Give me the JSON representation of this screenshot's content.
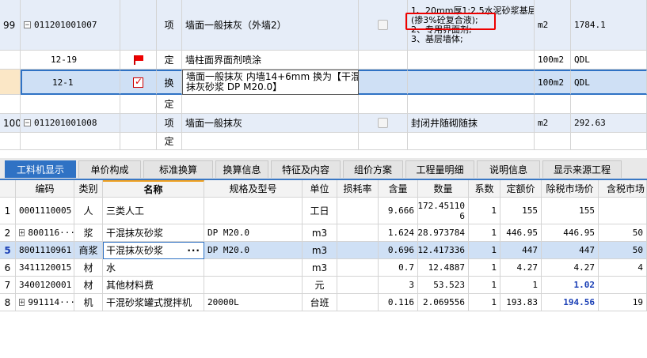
{
  "top_rows": [
    {
      "num": "99",
      "code": "011201001007",
      "type": "项",
      "name": "墙面一般抹灰（外墙2）",
      "feature_lines": [
        "1、20mm厚1:2.5水泥砂浆基层",
        "(掺3%砼复合液);",
        "2、专用界面剂;",
        "3、基层墙体;"
      ],
      "unit": "m2",
      "qty": "1784.1"
    },
    {
      "num": "",
      "code": "12-19",
      "type": "定",
      "name": "墙柱面界面剂喷涂",
      "feature_lines": [],
      "unit": "100m2",
      "qty": "QDL"
    },
    {
      "num": "",
      "code": "12-1",
      "type": "换",
      "name_lines": [
        "墙面一般抹灰 内墙14+6mm  换为【干混",
        "抹灰砂浆 DP M20.0】"
      ],
      "feature_lines": [],
      "unit": "100m2",
      "qty": "QDL"
    },
    {
      "num": "",
      "code": "",
      "type": "定",
      "name": "",
      "feature_lines": [],
      "unit": "",
      "qty": ""
    },
    {
      "num": "100",
      "code": "011201001008",
      "type": "项",
      "name": "墙面一般抹灰",
      "feature_lines": [
        "封闭井随砌随抹"
      ],
      "unit": "m2",
      "qty": "292.63"
    },
    {
      "num": "",
      "code": "",
      "type": "定",
      "name": "",
      "feature_lines": [],
      "unit": "",
      "qty": ""
    }
  ],
  "tabs": [
    "工料机显示",
    "单价构成",
    "标准换算",
    "换算信息",
    "特征及内容",
    "组价方案",
    "工程量明细",
    "说明信息",
    "显示来源工程"
  ],
  "columns": [
    "编码",
    "类别",
    "名称",
    "规格及型号",
    "单位",
    "损耗率",
    "含量",
    "数量",
    "系数",
    "定额价",
    "除税市场价",
    "含税市场"
  ],
  "rows": [
    {
      "idx": "1",
      "code": "0001110005",
      "cat": "人",
      "name": "三类人工",
      "spec": "",
      "unit": "工日",
      "loss": "",
      "content": "9.666",
      "qty_lines": [
        "172.45110",
        "6"
      ],
      "coef": "1",
      "price": "155",
      "market": "155",
      "tax_market": ""
    },
    {
      "idx": "2",
      "code": "800116···",
      "cat": "浆",
      "name": "干混抹灰砂浆",
      "spec": "DP M20.0",
      "unit": "m3",
      "loss": "",
      "content": "1.624",
      "qty_lines": [
        "28.973784"
      ],
      "coef": "1",
      "price": "446.95",
      "market": "446.95",
      "tax_market": "50"
    },
    {
      "idx": "5",
      "code": "8001110961",
      "cat": "商浆",
      "name": "干混抹灰砂浆",
      "spec": "DP M20.0",
      "unit": "m3",
      "loss": "",
      "content": "0.696",
      "qty_lines": [
        "12.417336"
      ],
      "coef": "1",
      "price": "447",
      "market": "447",
      "tax_market": "50"
    },
    {
      "idx": "6",
      "code": "3411120015",
      "cat": "材",
      "name": "水",
      "spec": "",
      "unit": "m3",
      "loss": "",
      "content": "0.7",
      "qty_lines": [
        "12.4887"
      ],
      "coef": "1",
      "price": "4.27",
      "market": "4.27",
      "tax_market": "4"
    },
    {
      "idx": "7",
      "code": "3400120001",
      "cat": "材",
      "name": "其他材料费",
      "spec": "",
      "unit": "元",
      "loss": "",
      "content": "3",
      "qty_lines": [
        "53.523"
      ],
      "coef": "1",
      "price": "1",
      "market": "1.02",
      "tax_market": ""
    },
    {
      "idx": "8",
      "code": "991114···",
      "cat": "机",
      "name": "干混砂浆罐式搅拌机",
      "spec": "20000L",
      "unit": "台班",
      "loss": "",
      "content": "0.116",
      "qty_lines": [
        "2.069556"
      ],
      "coef": "1",
      "price": "193.83",
      "market": "194.56",
      "tax_market": "19"
    }
  ],
  "icons": {
    "tree_expand": "plus-box-icon",
    "tree_collapse": "minus-box-icon",
    "flag": "red-flag-icon",
    "flag_checked": "red-flag-check-icon",
    "more": "ellipsis-icon"
  },
  "colors": {
    "active_tab": "#2f72c4",
    "row_highlight": "#e6edf8",
    "selected_row": "#cfe0f5",
    "annotation": "#e00000",
    "blue_value": "#1a3fb5"
  }
}
